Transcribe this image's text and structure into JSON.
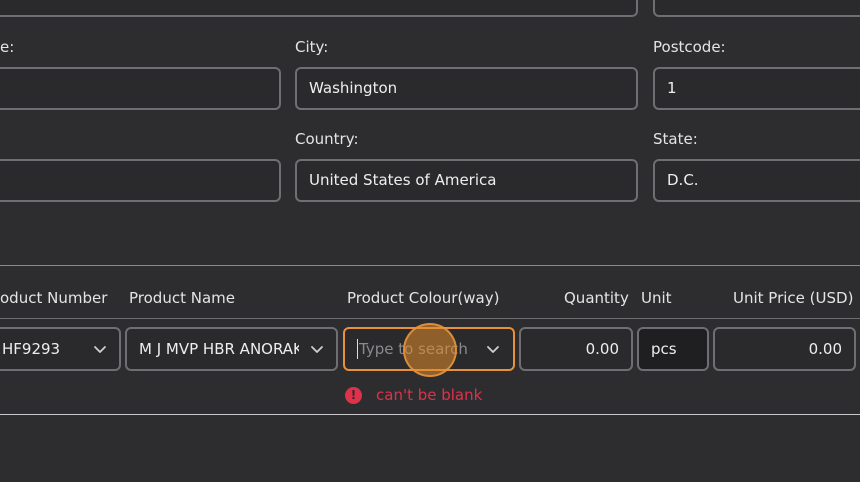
{
  "address": {
    "left_label": "e:",
    "city_label": "City:",
    "city_value": "Washington",
    "postcode_label": "Postcode:",
    "postcode_value": "1",
    "country_label": "Country:",
    "country_value": "United States of America",
    "state_label": "State:",
    "state_value": "D.C."
  },
  "items": {
    "headers": {
      "product_number": "oduct Number",
      "product_name": "Product Name",
      "product_colour": "Product Colour(way)",
      "quantity": "Quantity",
      "unit": "Unit",
      "unit_price": "Unit Price (USD)"
    },
    "row": {
      "product_number": "HF9293",
      "product_name": "M J MVP HBR ANORAK",
      "colour_placeholder": "Type to search...",
      "quantity": "0.00",
      "unit": "pcs",
      "unit_price": "0.00"
    },
    "error_text": "can't be blank"
  },
  "colors": {
    "focus": "#e8913a",
    "error": "#e0314b",
    "cursor_highlight": "#e08a2c"
  }
}
